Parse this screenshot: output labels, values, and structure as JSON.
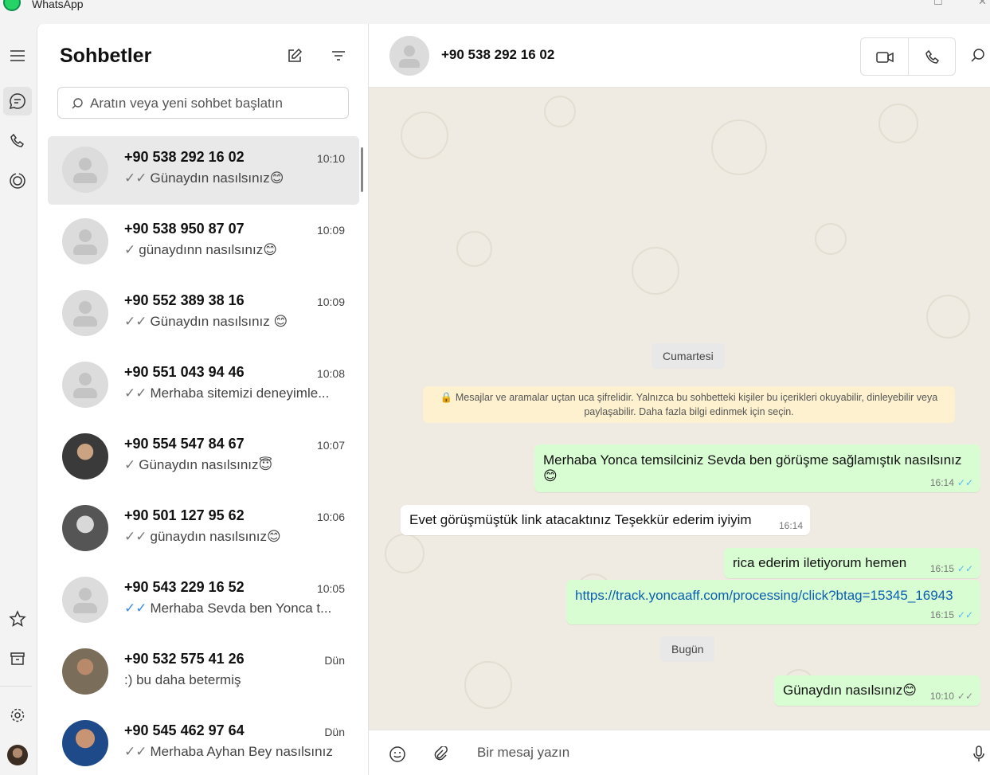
{
  "app": {
    "title": "WhatsApp"
  },
  "sidebar": {
    "title": "Sohbetler",
    "search_placeholder": "Aratın veya yeni sohbet başlatın",
    "chats": [
      {
        "name": "+90 538 292 16 02",
        "time": "10:10",
        "tick": "✓✓",
        "tick_color": "grey",
        "preview": "Günaydın nasılsınız😊"
      },
      {
        "name": "+90 538 950 87 07",
        "time": "10:09",
        "tick": "✓",
        "tick_color": "grey",
        "preview": "günaydınn nasılsınız😊"
      },
      {
        "name": "+90 552 389 38 16",
        "time": "10:09",
        "tick": "✓✓",
        "tick_color": "grey",
        "preview": "Günaydın nasılsınız 😊"
      },
      {
        "name": "+90 551 043 94 46",
        "time": "10:08",
        "tick": "✓✓",
        "tick_color": "grey",
        "preview": "Merhaba sitemizi deneyimle..."
      },
      {
        "name": "+90 554 547 84 67",
        "time": "10:07",
        "tick": "✓",
        "tick_color": "grey",
        "preview": "Günaydın nasılsınız😇"
      },
      {
        "name": "+90 501 127 95 62",
        "time": "10:06",
        "tick": "✓✓",
        "tick_color": "grey",
        "preview": "günaydın nasılsınız😊"
      },
      {
        "name": "+90 543 229 16 52",
        "time": "10:05",
        "tick": "✓✓",
        "tick_color": "blue",
        "preview": "Merhaba Sevda ben Yonca t..."
      },
      {
        "name": "+90 532 575 41 26",
        "time": "Dün",
        "tick": "",
        "tick_color": "grey",
        "preview": ":) bu daha betermiş"
      },
      {
        "name": "+90 545 462 97 64",
        "time": "Dün",
        "tick": "✓✓",
        "tick_color": "grey",
        "preview": "Merhaba Ayhan Bey nasılsınız"
      }
    ]
  },
  "conversation": {
    "contact_name": "+90 538 292 16 02",
    "day_1": "Cumartesi",
    "encryption_notice": "🔒 Mesajlar ve aramalar uçtan uca şifrelidir. Yalnızca bu sohbetteki kişiler bu içerikleri okuyabilir, dinleyebilir veya paylaşabilir. Daha fazla bilgi edinmek için seçin.",
    "messages": [
      {
        "direction": "out",
        "text_line1": "Merhaba Yonca temsilciniz Sevda ben görüşme sağlamıştık nasılsınız",
        "text_line2": "😊",
        "time": "16:14",
        "status": "✓✓"
      },
      {
        "direction": "in",
        "text": "Evet görüşmüştük link atacaktınız Teşekkür ederim iyiyim",
        "time": "16:14"
      },
      {
        "direction": "out",
        "text": "rica ederim iletiyorum hemen",
        "time": "16:15",
        "status": "✓✓"
      },
      {
        "direction": "out",
        "text": "https://track.yoncaaff.com/processing/click?btag=15345_16943",
        "time": "16:15",
        "status": "✓✓"
      },
      {
        "direction": "out",
        "text": "Günaydın nasılsınız😊",
        "time": "10:10",
        "status": "✓✓"
      }
    ],
    "day_2": "Bugün",
    "composer_placeholder": "Bir mesaj yazın"
  }
}
